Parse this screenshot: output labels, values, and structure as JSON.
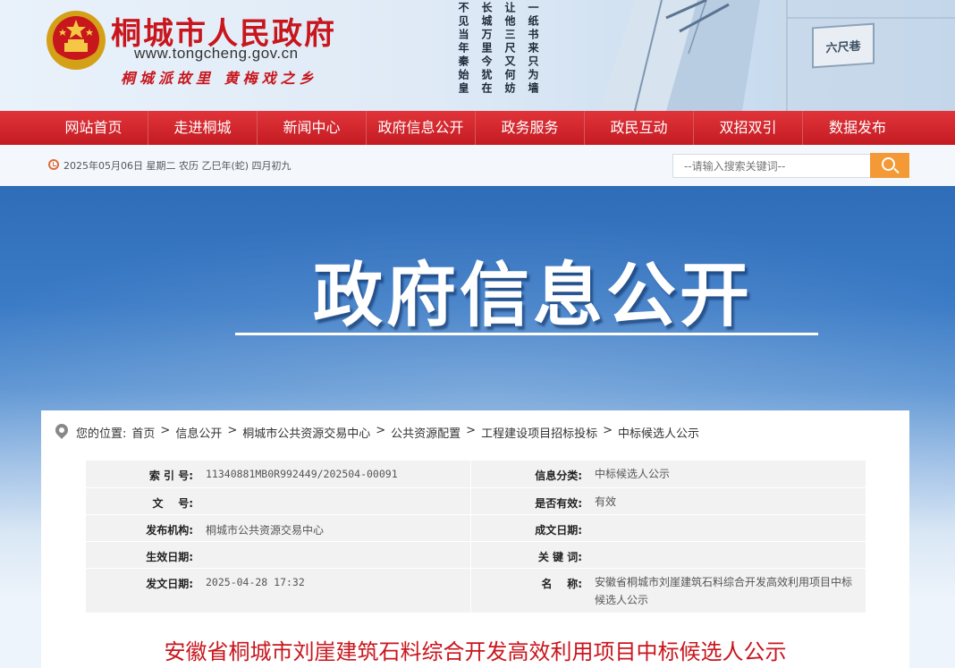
{
  "header": {
    "site_name": "桐城市人民政府",
    "site_url": "www.tongcheng.gov.cn",
    "slogan": "桐城派故里 黄梅戏之乡",
    "poem_columns": [
      "一纸书来只为墙",
      "让他三尺又何妨",
      "长城万里今犹在",
      "不见当年秦始皇"
    ],
    "alley_sign": "六尺巷",
    "colors": {
      "brand_red": "#c8161d",
      "nav_red": "#d52a30",
      "search_orange": "#f39a37"
    }
  },
  "nav": {
    "items": [
      "网站首页",
      "走进桐城",
      "新闻中心",
      "政府信息公开",
      "政务服务",
      "政民互动",
      "双招双引",
      "数据发布"
    ]
  },
  "infobar": {
    "date": "2025年05月06日 星期二 农历 乙巳年(蛇) 四月初九",
    "search_placeholder": "--请输入搜索关键词--"
  },
  "banner": {
    "title": "政府信息公开"
  },
  "breadcrumb": {
    "label": "您的位置:",
    "items": [
      "首页",
      "信息公开",
      "桐城市公共资源交易中心",
      "公共资源配置",
      "工程建设项目招标投标",
      "中标候选人公示"
    ]
  },
  "meta": {
    "rows": [
      {
        "k1": "索 引 号:",
        "v1": "11340881MB0R992449/202504-00091",
        "k2": "信息分类:",
        "v2": "中标候选人公示"
      },
      {
        "k1": "文    号:",
        "v1": "",
        "k2": "是否有效:",
        "v2": "有效"
      },
      {
        "k1": "发布机构:",
        "v1": "桐城市公共资源交易中心",
        "k2": "成文日期:",
        "v2": ""
      },
      {
        "k1": "生效日期:",
        "v1": "",
        "k2": "关 键 词:",
        "v2": ""
      },
      {
        "k1": "发文日期:",
        "v1": "2025-04-28 17:32",
        "k2": "名    称:",
        "v2": "安徽省桐城市刘崖建筑石料综合开发高效利用项目中标候选人公示"
      }
    ]
  },
  "article": {
    "title": "安徽省桐城市刘崖建筑石料综合开发高效利用项目中标候选人公示"
  }
}
